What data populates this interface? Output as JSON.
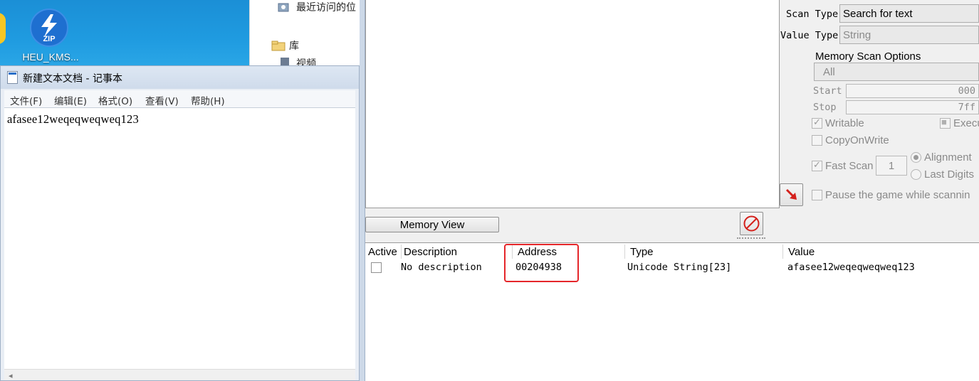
{
  "desktop": {
    "zip_icon_text": "ZIP",
    "zip_label": "HEU_KMS..."
  },
  "explorer": {
    "recent_places": "最近访问的位",
    "library": "库",
    "videos": "视频"
  },
  "notepad": {
    "title": "新建文本文档 - 记事本",
    "menu": [
      "文件(F)",
      "编辑(E)",
      "格式(O)",
      "查看(V)",
      "帮助(H)"
    ],
    "content": "afasee12weqeqweqweq123"
  },
  "cheat_engine": {
    "scan_type_label": "Scan Type",
    "scan_type_value": "Search for text",
    "value_type_label": "Value Type",
    "value_type_value": "String",
    "memory_scan_options_label": "Memory Scan Options",
    "region_value": "All",
    "start_label": "Start",
    "start_value": "000",
    "stop_label": "Stop",
    "stop_value": "7ff",
    "writable_label": "Writable",
    "executable_label": "Execu",
    "copyonwrite_label": "CopyOnWrite",
    "fast_scan_label": "Fast Scan",
    "fast_scan_value": "1",
    "alignment_label": "Alignment",
    "last_digits_label": "Last Digits",
    "pause_label": "Pause the game while scannin",
    "memory_view_button": "Memory View",
    "table": {
      "headers": [
        "Active",
        "Description",
        "Address",
        "Type",
        "Value"
      ],
      "rows": [
        {
          "description": "No description",
          "address": "00204938",
          "type": "Unicode String[23]",
          "value": "afasee12weqeqweqweq123"
        }
      ]
    }
  },
  "colors": {
    "highlight": "#e5262a",
    "desktop_blue": "#1f9be0"
  }
}
